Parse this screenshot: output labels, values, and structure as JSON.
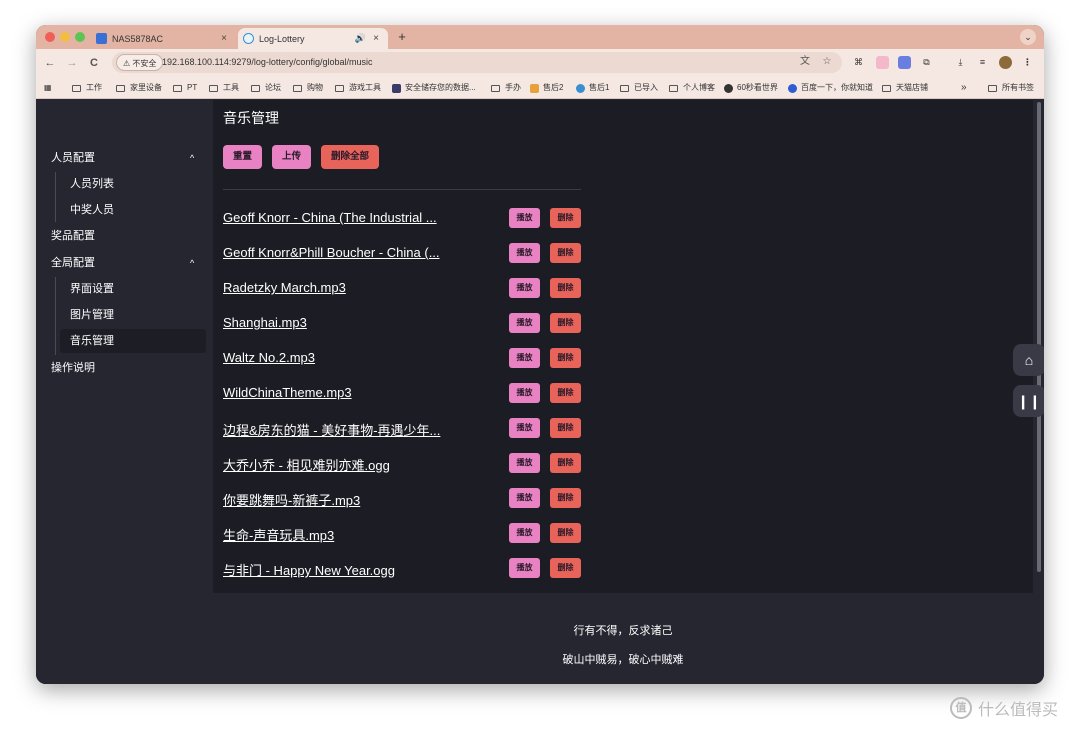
{
  "browser": {
    "tabs": [
      {
        "title": "NAS5878AC",
        "close": "×"
      },
      {
        "title": "Log-Lottery",
        "close": "×"
      }
    ],
    "new_tab": "+",
    "tab_menu": "⌄",
    "nav": {
      "back": "←",
      "forward": "→",
      "reload": "C"
    },
    "security_badge": "⚠ 不安全",
    "url": "192.168.100.114:9279/log-lottery/config/global/music",
    "bookmarks": [
      "工作",
      "家里设备",
      "PT",
      "工具",
      "论坛",
      "购物",
      "游戏工具",
      "安全储存您的数据...",
      "手办",
      "售后2",
      "售后1",
      "已导入",
      "个人博客",
      "60秒看世界",
      "百度一下，你就知道",
      "天猫店铺"
    ],
    "bookmarks_more": "»",
    "all_bookmarks": "所有书签"
  },
  "sidebar": {
    "groups": [
      {
        "label": "人员配置",
        "chevron": "^",
        "children": [
          "人员列表",
          "中奖人员"
        ]
      },
      {
        "label": "奖品配置"
      },
      {
        "label": "全局配置",
        "chevron": "^",
        "children": [
          "界面设置",
          "图片管理",
          "音乐管理"
        ]
      },
      {
        "label": "操作说明"
      }
    ]
  },
  "main": {
    "title": "音乐管理",
    "buttons": {
      "reset": "重置",
      "upload": "上传",
      "delete_all": "删除全部"
    },
    "play_label": "播放",
    "delete_label": "删除",
    "songs": [
      "Geoff Knorr - China (The Industrial ...",
      "Geoff Knorr&Phill Boucher - China (...",
      "Radetzky March.mp3",
      "Shanghai.mp3",
      "Waltz No.2.mp3",
      "WildChinaTheme.mp3",
      "边程&房东的猫 - 美好事物-再遇少年...",
      "大乔小乔 - 相见难别亦难.ogg",
      "你要跳舞吗-新裤子.mp3",
      "生命-声音玩具.mp3",
      "与非门 - Happy New Year.ogg"
    ]
  },
  "footer": {
    "line1": "行有不得，反求诸己",
    "line2": "破山中贼易，破心中贼难"
  },
  "watermark": {
    "logo": "值",
    "text": "什么值得买"
  },
  "colors": {
    "play": "#e982c3",
    "delete": "#e8645a",
    "background": "#262631",
    "content": "#1c1c24"
  }
}
